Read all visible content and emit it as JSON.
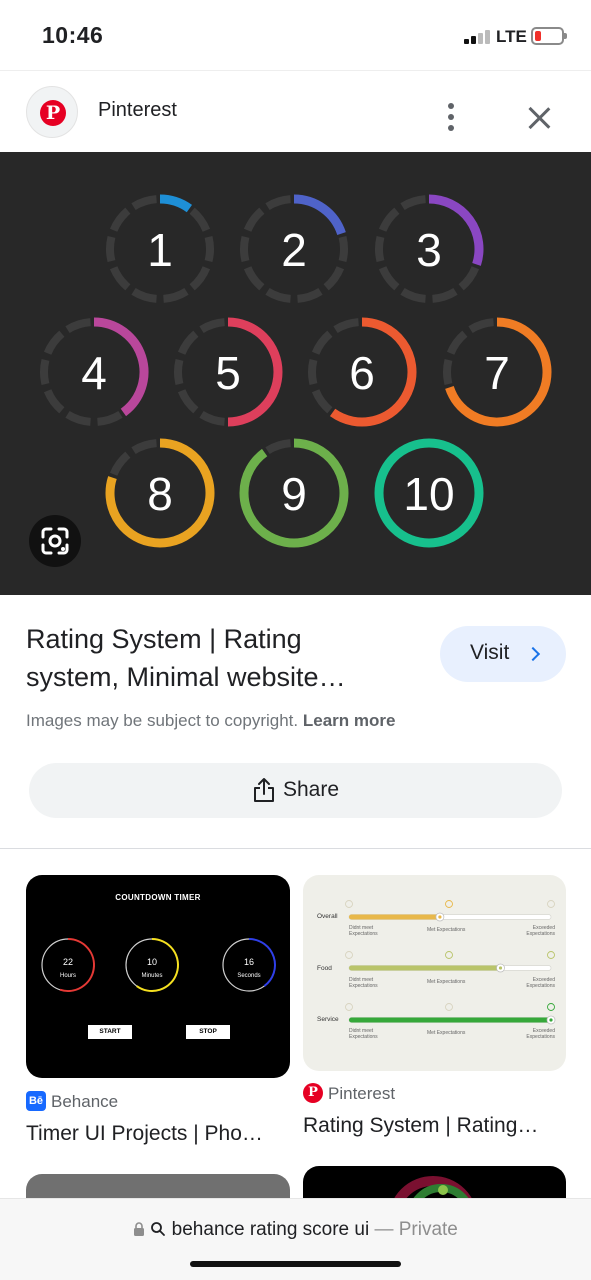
{
  "status": {
    "time": "10:46",
    "network": "LTE"
  },
  "source": {
    "name": "Pinterest"
  },
  "hero": {
    "rings": [
      {
        "label": "1",
        "color": "#1e8fd6",
        "level": 0.1
      },
      {
        "label": "2",
        "color": "#4f63c9",
        "level": 0.2
      },
      {
        "label": "3",
        "color": "#8a47c2",
        "level": 0.3
      },
      {
        "label": "4",
        "color": "#b9479b",
        "level": 0.4
      },
      {
        "label": "5",
        "color": "#de3f5c",
        "level": 0.5
      },
      {
        "label": "6",
        "color": "#ec5a30",
        "level": 0.6
      },
      {
        "label": "7",
        "color": "#f07c24",
        "level": 0.7
      },
      {
        "label": "8",
        "color": "#e9a321",
        "level": 0.8
      },
      {
        "label": "9",
        "color": "#6db04b",
        "level": 0.9
      },
      {
        "label": "10",
        "color": "#17c08d",
        "level": 1.0
      }
    ]
  },
  "result": {
    "title_line1": "Rating System | Rating",
    "title_line2": "system, Minimal website…",
    "visit_label": "Visit",
    "copyright_text": "Images may be subject to copyright. ",
    "learn_more": "Learn more",
    "share_label": "Share"
  },
  "related": [
    {
      "source": "Behance",
      "title": "Timer UI Projects | Pho…",
      "image": {
        "heading": "COUNTDOWN TIMER",
        "timers": [
          {
            "value": "22",
            "unit": "Hours",
            "color": "#e53935",
            "level": 0.55
          },
          {
            "value": "10",
            "unit": "Minutes",
            "color": "#f5e020",
            "level": 0.6
          },
          {
            "value": "16",
            "unit": "Seconds",
            "color": "#2f3fe8",
            "level": 0.4
          }
        ],
        "start": "START",
        "stop": "STOP"
      }
    },
    {
      "source": "Pinterest",
      "title": "Rating System | Rating…",
      "image": {
        "rows": [
          {
            "label": "Overall",
            "color": "#e8b84a",
            "level": 0.45
          },
          {
            "label": "Food",
            "color": "#b9c46a",
            "level": 0.75
          },
          {
            "label": "Service",
            "color": "#36a83a",
            "level": 1.0
          }
        ],
        "low": "Didnt meet Expectations",
        "mid": "Met Expectations",
        "high": "Exceeded Expectations"
      }
    }
  ],
  "browser": {
    "query": "behance rating score ui",
    "suffix": " — Private"
  }
}
